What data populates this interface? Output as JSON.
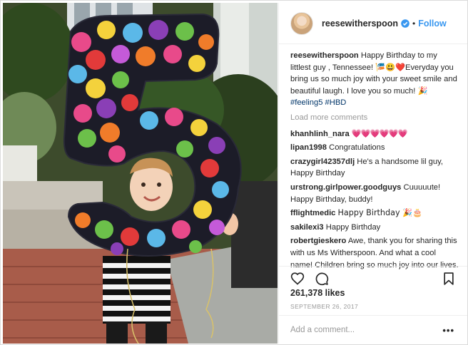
{
  "post": {
    "author": "reesewitherspoon",
    "follow_label": "Follow",
    "separator": "•",
    "caption_text": "Happy Birthday to my littlest guy , Tennessee! 🎏😃❤️Everyday you bring us so much joy with your sweet smile and beautiful laugh. I love you so much! 🎉",
    "hashtags": [
      "#feeling5",
      "#HBD"
    ],
    "load_more_label": "Load more comments",
    "comments": [
      {
        "user": "khanhlinh_nara",
        "text": "💗💗💗💗💗💗"
      },
      {
        "user": "lipan1998",
        "text": "Congratulations"
      },
      {
        "user": "crazygirl42357dlj",
        "text": "He's a handsome lil guy, Happy Birthday"
      },
      {
        "user": "urstrong.girlpower.goodguys",
        "text": "Cuuuuute! Happy Birthday, buddy!"
      },
      {
        "user": "fflightmedic",
        "text": "Happy Birthday 🎉🎂"
      },
      {
        "user": "sakilexi3",
        "text": "Happy Birthday"
      },
      {
        "user": "robertgieskero",
        "text": "Awe, thank you for sharing this with us Ms Witherspoon. And what a cool name! Children bring so much joy into our lives."
      }
    ],
    "likes": "261,378 likes",
    "date": "SEPTEMBER 26, 2017",
    "add_comment_placeholder": "Add a comment...",
    "more_label": "•••"
  },
  "icons": {
    "like": "heart-outline-icon",
    "comment": "speech-bubble-icon",
    "save": "bookmark-icon",
    "verified": "verified-badge-icon"
  },
  "colors": {
    "link_blue": "#3897f0",
    "hashtag_blue": "#003569",
    "muted_gray": "#999999",
    "text": "#262626",
    "balloon_dots": [
      "#e84a8a",
      "#f4d23c",
      "#5bb8e8",
      "#8a3fb6",
      "#f07c2a",
      "#6cc04a",
      "#e23a3a",
      "#c45ad8"
    ]
  }
}
